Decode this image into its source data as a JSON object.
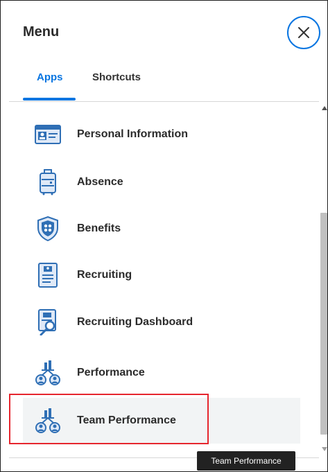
{
  "menu": {
    "title": "Menu",
    "close_icon": "close-icon"
  },
  "tabs": [
    {
      "label": "Apps",
      "active": true
    },
    {
      "label": "Shortcuts",
      "active": false
    }
  ],
  "apps": [
    {
      "label": "Personal Information",
      "icon": "id-card-icon"
    },
    {
      "label": "Absence",
      "icon": "luggage-icon"
    },
    {
      "label": "Benefits",
      "icon": "shield-icon"
    },
    {
      "label": "Recruiting",
      "icon": "document-icon"
    },
    {
      "label": "Recruiting Dashboard",
      "icon": "document-search-icon"
    },
    {
      "label": "Performance",
      "icon": "people-chart-icon"
    },
    {
      "label": "Team Performance",
      "icon": "people-chart-icon",
      "selected": true
    }
  ],
  "tooltip": {
    "text": "Team Performance"
  },
  "colors": {
    "accent": "#0875e1",
    "highlight_border": "#e6262e",
    "icon_blue": "#2f6fb5"
  }
}
